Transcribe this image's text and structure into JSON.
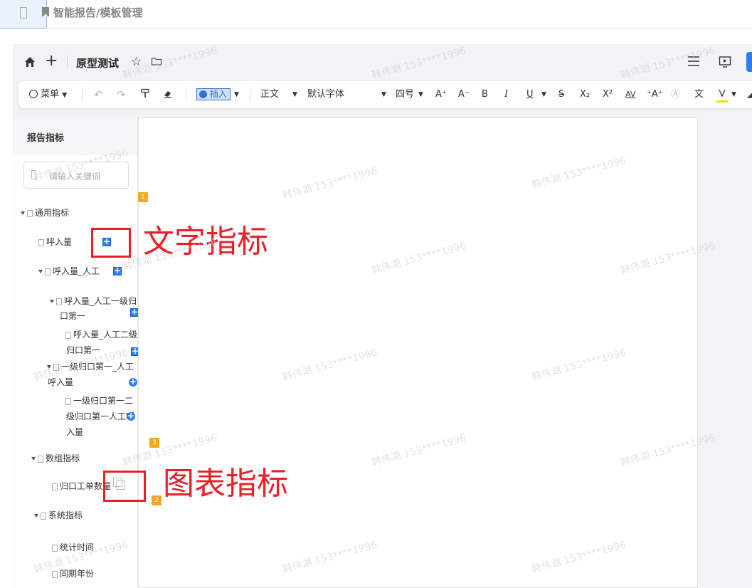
{
  "header": {
    "breadcrumb": "智能报告/模板管理"
  },
  "doc": {
    "title": "原型测试"
  },
  "toolbar": {
    "menu": "菜单",
    "insert": "插入",
    "paragraph_style": "正文",
    "font": "默认字体",
    "font_size": "四号",
    "font_grow": "A⁺",
    "font_shrink": "A⁻",
    "bold": "B",
    "italic": "I",
    "underline": "U",
    "strike": "S",
    "subscript": "X₂",
    "superscript": "X²",
    "char_spacing": "AV",
    "clear_case": "⁺A⁺",
    "circle_char": "Ⓐ",
    "phonetic": "文"
  },
  "sidebar": {
    "title": "报告指标",
    "search_placeholder": "请输入关键词",
    "tree": {
      "general": "通用指标",
      "inbound": "呼入量",
      "inbound_manual": "呼入量_人工",
      "l1_line1": "呼入量_人工一级归",
      "l1_line2": "口第一",
      "l2_line1": "呼入量_人工二级",
      "l2_line2": "归口第一",
      "m1_line1": "一级归口第一_人工",
      "m1_line2": "呼入量",
      "m2_line1": "一级归口第一二",
      "m2_line2": "级归口第一人工呼",
      "m2_line3": "入量",
      "data": "数组指标",
      "workorders": "归口工单数量",
      "system": "系统指标",
      "stat_time": "统计时间",
      "same_period": "同期年份"
    }
  },
  "canvas": {
    "badges": [
      "1",
      "2",
      "3"
    ]
  },
  "annotations": {
    "text_metric": "文字指标",
    "chart_metric": "图表指标"
  },
  "watermark": "韩伟湖 153****1996"
}
